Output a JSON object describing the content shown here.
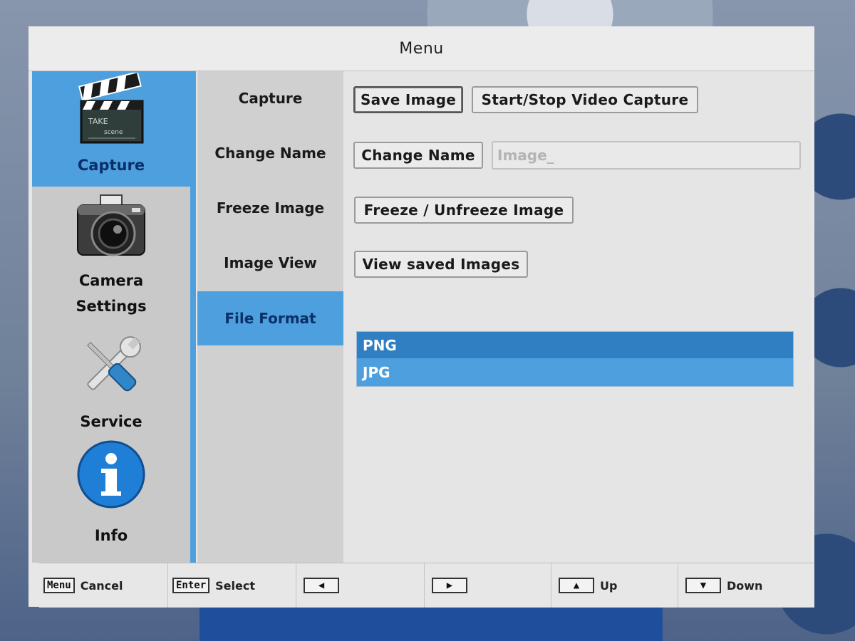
{
  "window": {
    "title": "Menu"
  },
  "categories": [
    {
      "label": "Capture",
      "icon": "clapperboard-icon",
      "active": true
    },
    {
      "label": "Camera\nSettings",
      "icon": "camera-icon",
      "active": false
    },
    {
      "label": "Service",
      "icon": "wrench-screwdriver-icon",
      "active": false
    },
    {
      "label": "Info",
      "icon": "info-icon",
      "active": false
    }
  ],
  "submenu": [
    {
      "label": "Capture"
    },
    {
      "label": "Change Name"
    },
    {
      "label": "Freeze Image"
    },
    {
      "label": "Image View"
    },
    {
      "label": "File Format",
      "active": true
    }
  ],
  "content": {
    "capture": {
      "save_image": "Save Image",
      "video_capture": "Start/Stop Video Capture"
    },
    "change_name": {
      "button": "Change Name",
      "input_value": "Image_"
    },
    "freeze": {
      "button": "Freeze / Unfreeze Image"
    },
    "view": {
      "button": "View saved Images"
    },
    "file_format": {
      "options": [
        "PNG",
        "JPG"
      ],
      "selected": "PNG"
    }
  },
  "bottombar": [
    {
      "key": "Menu",
      "label": "Cancel"
    },
    {
      "key": "Enter",
      "label": "Select"
    },
    {
      "key": "◀",
      "label": ""
    },
    {
      "key": "▶",
      "label": ""
    },
    {
      "key": "▲",
      "label": "Up"
    },
    {
      "key": "▼",
      "label": "Down"
    }
  ],
  "colors": {
    "accent": "#4da0dd",
    "selected_item": "#2f7fc2",
    "panel": "#d0d0d0"
  }
}
